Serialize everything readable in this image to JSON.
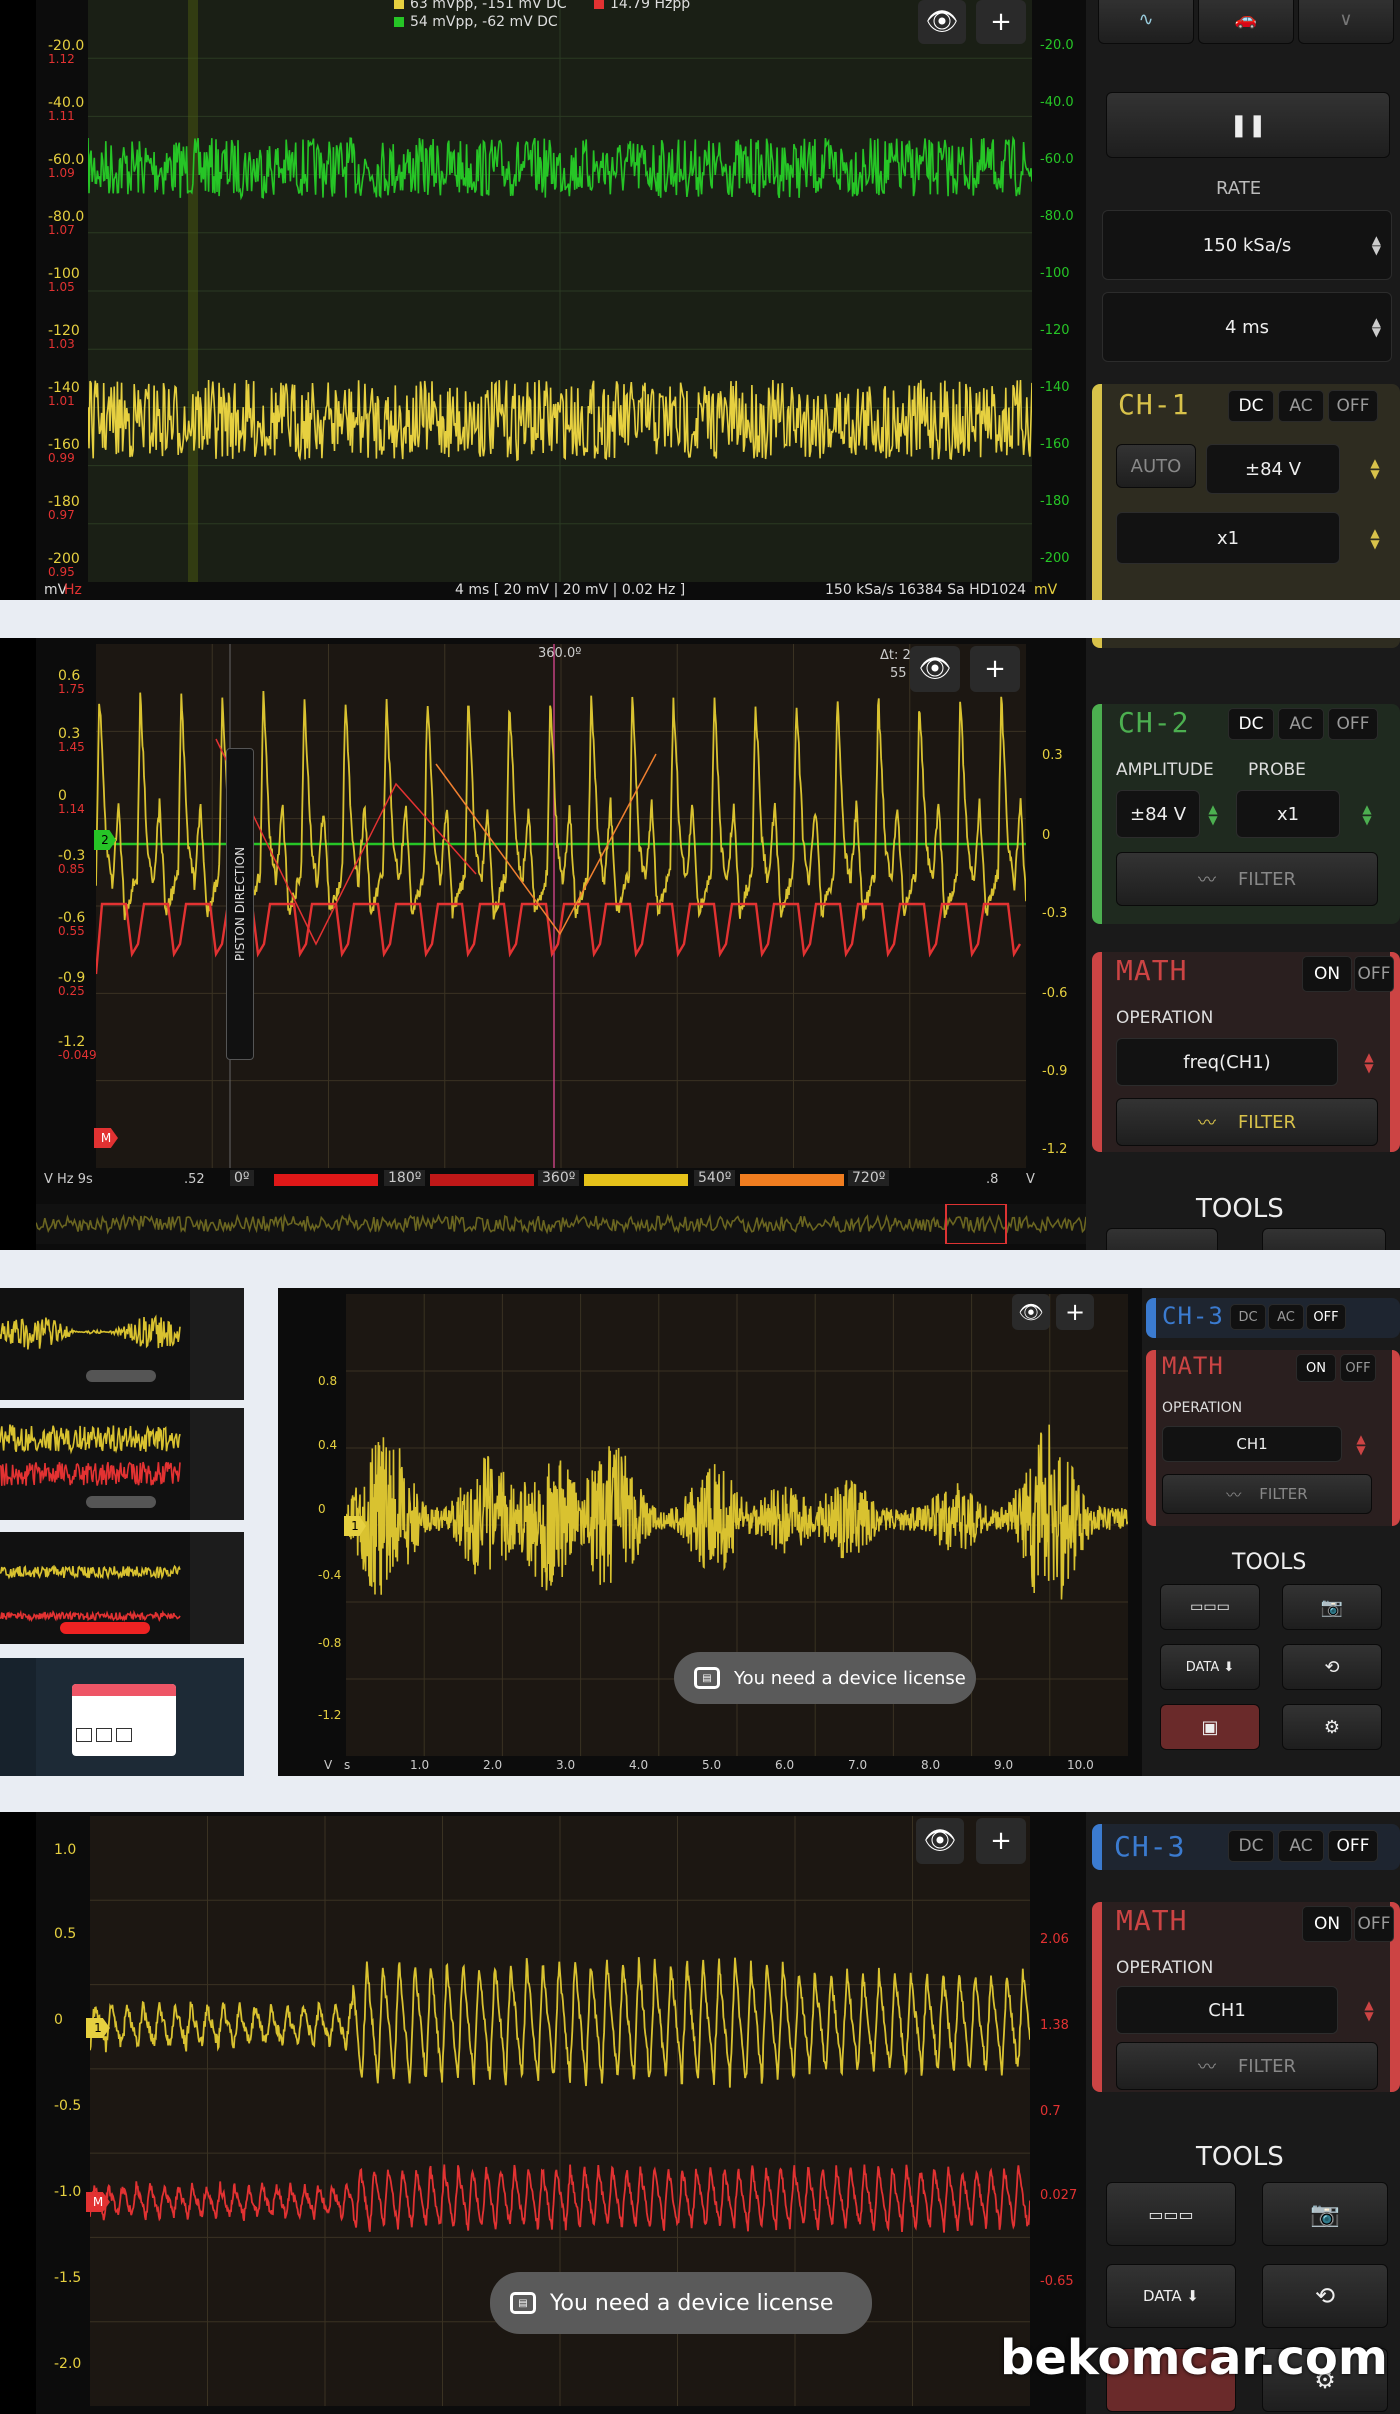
{
  "colors": {
    "yellow": "#e6d040",
    "green": "#26c526",
    "red": "#e23232",
    "orange": "#f07d20",
    "grid": "#3a3a2a"
  },
  "s1": {
    "legend": [
      {
        "text": "63 mVpp, -151 mV DC",
        "color": "#e6d040"
      },
      {
        "text": "54 mVpp, -62 mV DC",
        "color": "#26c526"
      },
      {
        "text": "14.79 Hzpp",
        "color": "#e23232"
      }
    ],
    "left_ticks": [
      {
        "v": "-20.0",
        "s": "1.12"
      },
      {
        "v": "-40.0",
        "s": "1.11"
      },
      {
        "v": "-60.0",
        "s": "1.09"
      },
      {
        "v": "-80.0",
        "s": "1.07"
      },
      {
        "v": "-100",
        "s": "1.05"
      },
      {
        "v": "-120",
        "s": "1.03"
      },
      {
        "v": "-140",
        "s": "1.01"
      },
      {
        "v": "-160",
        "s": "0.99"
      },
      {
        "v": "-180",
        "s": "0.97"
      },
      {
        "v": "-200",
        "s": "0.95"
      }
    ],
    "right_ticks": [
      "-20.0",
      "-40.0",
      "-60.0",
      "-80.0",
      "-100",
      "-120",
      "-140",
      "-160",
      "-180",
      "-200"
    ],
    "unit_left": "mV",
    "unit_left2": "Hz",
    "unit_right": "mV",
    "status_center": "4 ms  [ 20 mV | 20 mV | 0.02 Hz ]",
    "status_right": "150 kSa/s   16384 Sa   HD1024",
    "rate_label": "RATE",
    "rate_value": "150 kSa/s",
    "time_value": "4 ms",
    "ch1": {
      "title": "CH-1",
      "dc": "DC",
      "ac": "AC",
      "off": "OFF",
      "auto": "AUTO",
      "range": "±84 V",
      "probe": "x1"
    }
  },
  "s2": {
    "top_marker": "360.0º",
    "delta": "Δt: 2",
    "delta2": "55",
    "left_ticks": [
      {
        "v": "0.6",
        "s": "1.75"
      },
      {
        "v": "0.3",
        "s": "1.45"
      },
      {
        "v": "0",
        "s": "1.14"
      },
      {
        "v": "-0.3",
        "s": "0.85"
      },
      {
        "v": "-0.6",
        "s": "0.55"
      },
      {
        "v": "-0.9",
        "s": "0.25"
      },
      {
        "v": "-1.2",
        "s": "-0.049"
      }
    ],
    "right_ticks": [
      "0.3",
      "0",
      "-0.3",
      "-0.6",
      "-0.9",
      "-1.2"
    ],
    "piston": "PISTON DIRECTION",
    "ch_marker": "2",
    "m_marker": "M",
    "bottom_left": "V  Hz  9s",
    "bottom_52": ".52",
    "bottom_8": ".8",
    "bottom_v": "V",
    "degrees": [
      "0º",
      "180º",
      "360º",
      "540º",
      "720º"
    ],
    "ch2": {
      "title": "CH-2",
      "dc": "DC",
      "ac": "AC",
      "off": "OFF",
      "amp_label": "AMPLITUDE",
      "probe_label": "PROBE",
      "amp": "±84 V",
      "probe": "x1",
      "filter": "FILTER"
    },
    "math": {
      "title": "MATH",
      "on": "ON",
      "off": "OFF",
      "op_label": "OPERATION",
      "op": "freq(CH1)",
      "filter": "FILTER"
    },
    "tools": "TOOLS"
  },
  "s3": {
    "left_ticks": [
      "0.8",
      "0.4",
      "0",
      "-0.4",
      "-0.8",
      "-1.2"
    ],
    "x_ticks": [
      "1.0",
      "2.0",
      "3.0",
      "4.0",
      "5.0",
      "6.0",
      "7.0",
      "8.0",
      "9.0",
      "10.0"
    ],
    "axis_v": "V",
    "axis_s": "s",
    "ch_marker": "1",
    "toast": "You need a device license",
    "ch3": {
      "title": "CH-3",
      "dc": "DC",
      "ac": "AC",
      "off": "OFF"
    },
    "math": {
      "title": "MATH",
      "on": "ON",
      "off": "OFF",
      "op_label": "OPERATION",
      "op": "CH1",
      "filter": "FILTER"
    },
    "tools": "TOOLS",
    "data_btn": "DATA ⬇"
  },
  "s4": {
    "left_ticks": [
      "1.0",
      "0.5",
      "0",
      "-0.5",
      "-1.0",
      "-1.5",
      "-2.0"
    ],
    "right_ticks": [
      "2.06",
      "1.38",
      "0.7",
      "0.027",
      "-0.65"
    ],
    "ch_marker": "1",
    "m_marker": "M",
    "toast": "You need a device license",
    "ch3": {
      "title": "CH-3",
      "dc": "DC",
      "ac": "AC",
      "off": "OFF"
    },
    "math": {
      "title": "MATH",
      "on": "ON",
      "off": "OFF",
      "op_label": "OPERATION",
      "op": "CH1",
      "filter": "FILTER"
    },
    "tools": "TOOLS",
    "data_btn": "DATA ⬇",
    "watermark": "bekomcar.com"
  }
}
